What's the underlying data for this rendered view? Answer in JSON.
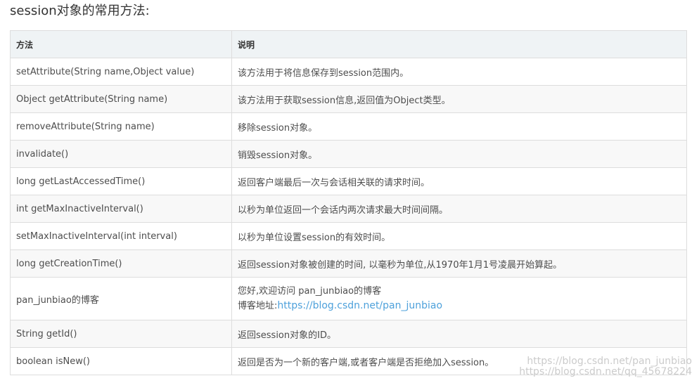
{
  "heading": "session对象的常用方法:",
  "table": {
    "headers": [
      "方法",
      "说明"
    ],
    "rows": [
      {
        "method": "setAttribute(String name,Object value)",
        "desc": "该方法用于将信息保存到session范围内。"
      },
      {
        "method": "Object getAttribute(String name)",
        "desc": "该方法用于获取session信息,返回值为Object类型。"
      },
      {
        "method": "removeAttribute(String name)",
        "desc": "移除session对象。"
      },
      {
        "method": "invalidate()",
        "desc": "销毁session对象。"
      },
      {
        "method": "long getLastAccessedTime()",
        "desc": "返回客户端最后一次与会话相关联的请求时间。"
      },
      {
        "method": "int getMaxInactiveInterval()",
        "desc": "以秒为单位返回一个会话内两次请求最大时间间隔。"
      },
      {
        "method": "setMaxInactiveInterval(int interval)",
        "desc": "以秒为单位设置session的有效时间。"
      },
      {
        "method": "long getCreationTime()",
        "desc": "返回session对象被创建的时间, 以毫秒为单位,从1970年1月1号凌晨开始算起。"
      },
      {
        "method": "pan_junbiao的博客",
        "desc_line1": "您好,欢迎访问 pan_junbiao的博客",
        "desc_line2_label": "博客地址:",
        "desc_link": "https://blog.csdn.net/pan_junbiao"
      },
      {
        "method": "String getId()",
        "desc": "返回session对象的ID。"
      },
      {
        "method": "boolean isNew()",
        "desc": "返回是否为一个新的客户端,或者客户端是否拒绝加入session。"
      }
    ]
  },
  "watermark": {
    "line1": "https://blog.csdn.net/pan_junbiao",
    "line2": "https://blog.csdn.net/qq_45678224"
  }
}
